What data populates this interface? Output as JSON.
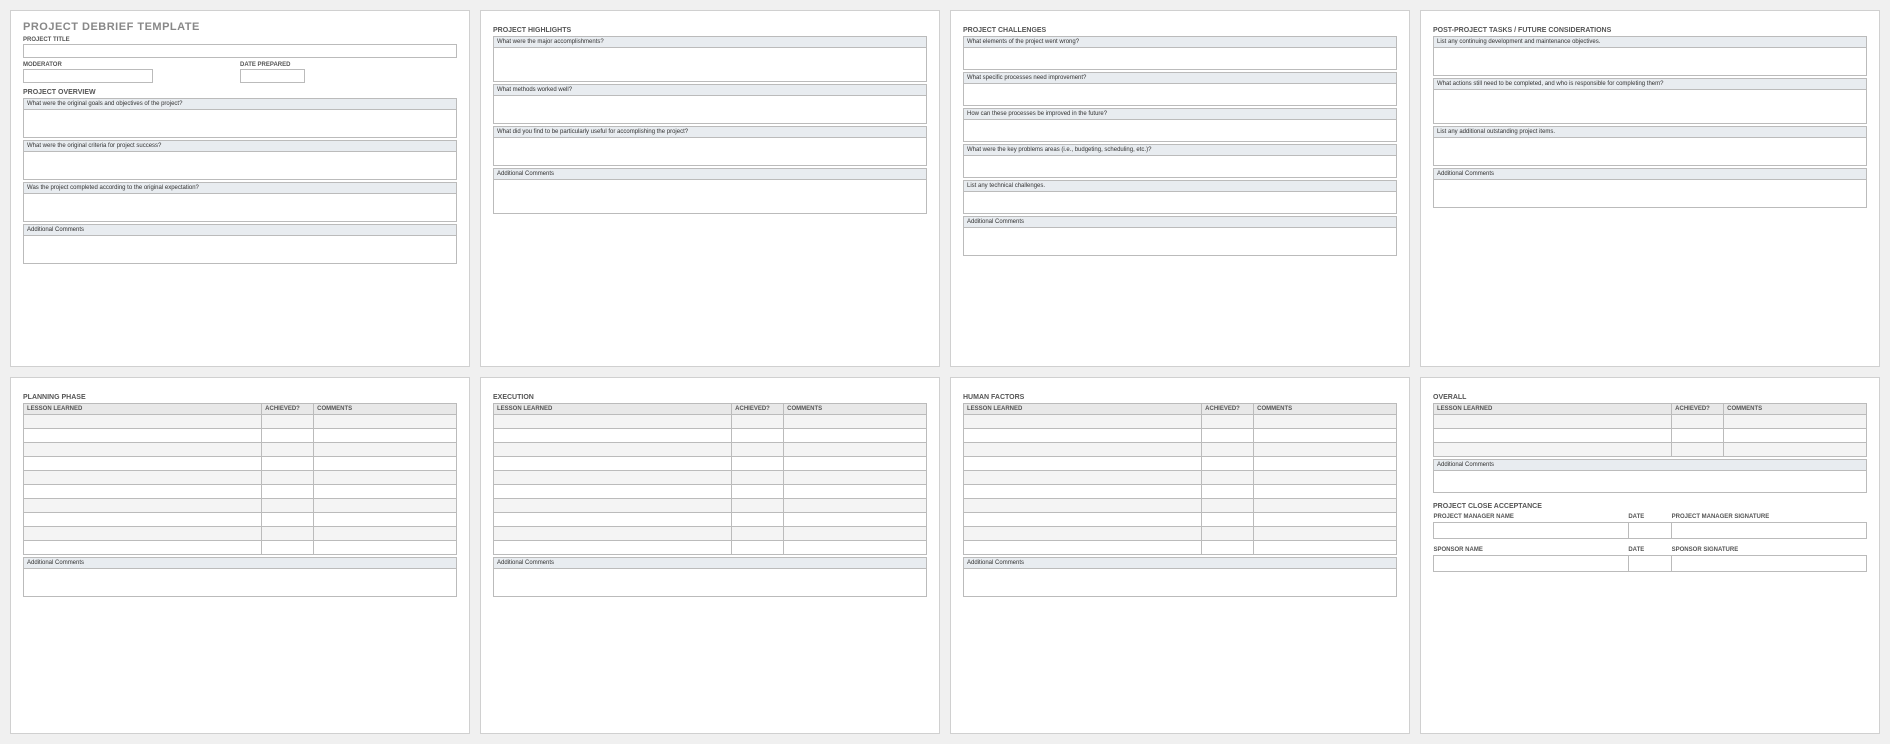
{
  "doc_title": "PROJECT DEBRIEF TEMPLATE",
  "page1": {
    "project_title_label": "PROJECT TITLE",
    "moderator_label": "MODERATOR",
    "date_prepared_label": "DATE PREPARED",
    "overview_title": "PROJECT OVERVIEW",
    "q1": "What were the original goals and objectives of the project?",
    "q2": "What were the original criteria for project success?",
    "q3": "Was the project completed according to the original expectation?",
    "additional": "Additional Comments"
  },
  "page2": {
    "title": "PROJECT HIGHLIGHTS",
    "q1": "What were the major accomplishments?",
    "q2": "What methods worked well?",
    "q3": "What did you find to be particularly useful for accomplishing the project?",
    "additional": "Additional Comments"
  },
  "page3": {
    "title": "PROJECT CHALLENGES",
    "q1": "What elements of the project went wrong?",
    "q2": "What specific processes need improvement?",
    "q3": "How can these processes be improved in the future?",
    "q4": "What were the key problems areas (i.e., budgeting, scheduling, etc.)?",
    "q5": "List any technical challenges.",
    "additional": "Additional Comments"
  },
  "page4": {
    "title": "POST-PROJECT TASKS / FUTURE CONSIDERATIONS",
    "q1": "List any continuing development and maintenance objectives.",
    "q2": "What actions still need to be completed, and who is responsible for completing them?",
    "q3": "List any additional outstanding project items.",
    "additional": "Additional Comments"
  },
  "lessons_table": {
    "col_lesson": "LESSON LEARNED",
    "col_achieved": "ACHIEVED?",
    "col_comments": "COMMENTS",
    "additional": "Additional Comments"
  },
  "page5": {
    "title": "PLANNING PHASE"
  },
  "page6": {
    "title": "EXECUTION"
  },
  "page7": {
    "title": "HUMAN FACTORS"
  },
  "page8": {
    "overall_title": "OVERALL",
    "additional": "Additional Comments",
    "close_title": "PROJECT CLOSE ACCEPTANCE",
    "pm_name": "PROJECT MANAGER NAME",
    "date": "DATE",
    "pm_sig": "PROJECT MANAGER SIGNATURE",
    "sponsor_name": "SPONSOR NAME",
    "sponsor_sig": "SPONSOR SIGNATURE"
  }
}
